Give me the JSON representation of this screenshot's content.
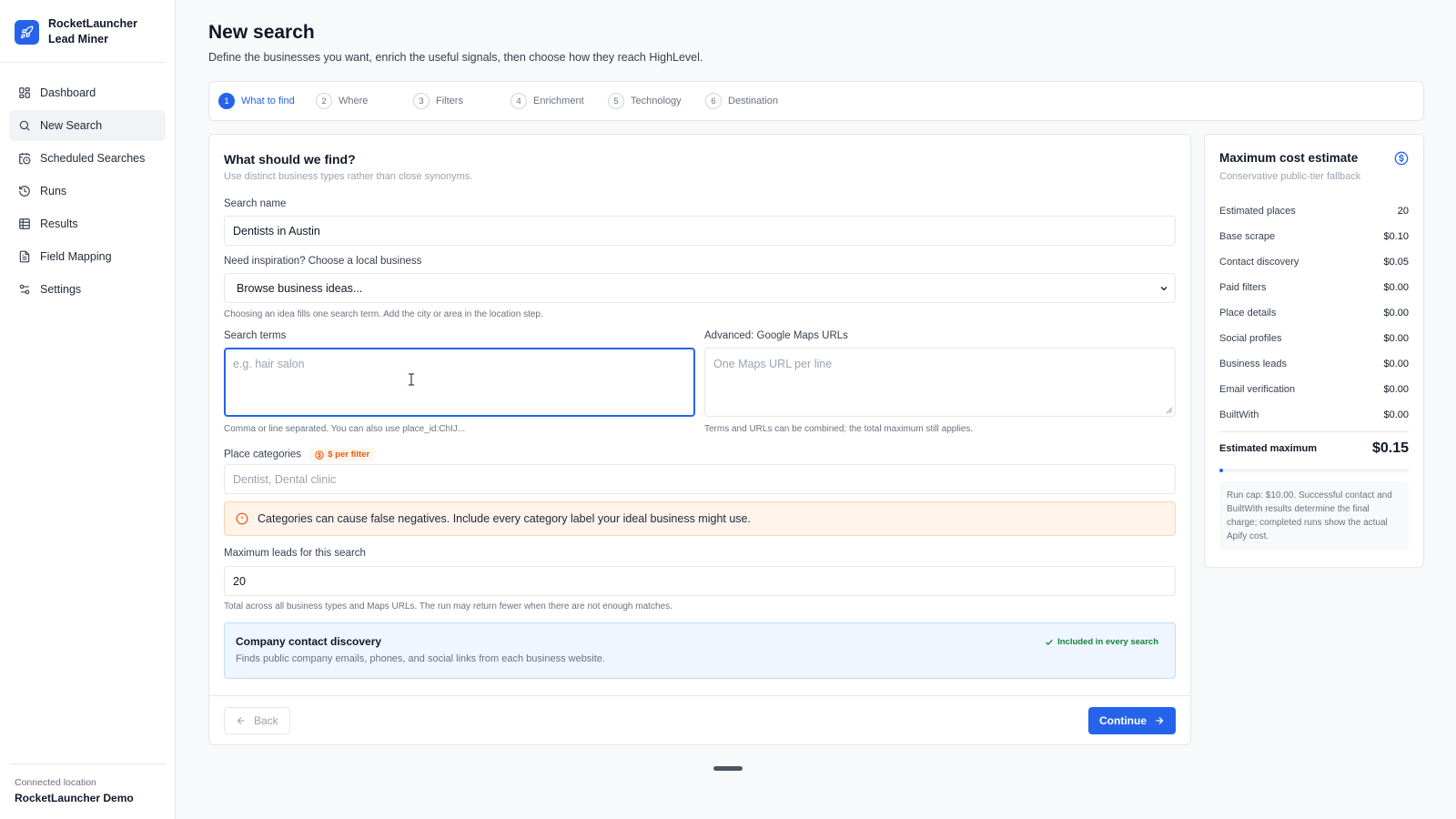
{
  "sidebar": {
    "brand_line1": "RocketLauncher",
    "brand_line2": "Lead Miner",
    "items": [
      {
        "label": "Dashboard"
      },
      {
        "label": "New Search"
      },
      {
        "label": "Scheduled Searches"
      },
      {
        "label": "Runs"
      },
      {
        "label": "Results"
      },
      {
        "label": "Field Mapping"
      },
      {
        "label": "Settings"
      }
    ],
    "footer_label": "Connected location",
    "footer_value": "RocketLauncher Demo"
  },
  "header": {
    "title": "New search",
    "subtitle": "Define the businesses you want, enrich the useful signals, then choose how they reach HighLevel."
  },
  "steps": [
    {
      "num": "1",
      "label": "What to find"
    },
    {
      "num": "2",
      "label": "Where"
    },
    {
      "num": "3",
      "label": "Filters"
    },
    {
      "num": "4",
      "label": "Enrichment"
    },
    {
      "num": "5",
      "label": "Technology"
    },
    {
      "num": "6",
      "label": "Destination"
    }
  ],
  "form": {
    "title": "What should we find?",
    "subtitle": "Use distinct business types rather than close synonyms.",
    "search_name_label": "Search name",
    "search_name_value": "Dentists in Austin",
    "inspiration_label": "Need inspiration? Choose a local business",
    "inspiration_value": "Browse business ideas...",
    "inspiration_help": "Choosing an idea fills one search term. Add the city or area in the location step.",
    "terms_label": "Search terms",
    "terms_placeholder": "e.g. hair salon",
    "terms_help": "Comma or line separated. You can also use place_id:ChIJ...",
    "urls_label": "Advanced: Google Maps URLs",
    "urls_placeholder": "One Maps URL per line",
    "urls_help": "Terms and URLs can be combined; the total maximum still applies.",
    "categories_label": "Place categories",
    "categories_badge": "$ per filter",
    "categories_placeholder": "Dentist, Dental clinic",
    "alert_text": "Categories can cause false negatives. Include every category label your ideal business might use.",
    "max_leads_label": "Maximum leads for this search",
    "max_leads_value": "20",
    "max_leads_help": "Total across all business types and Maps URLs. The run may return fewer when there are not enough matches.",
    "contact_title": "Company contact discovery",
    "contact_desc": "Finds public company emails, phones, and social links from each business website.",
    "contact_badge": "Included in every search",
    "back_label": "Back",
    "continue_label": "Continue"
  },
  "cost": {
    "title": "Maximum cost estimate",
    "subtitle": "Conservative public-tier fallback",
    "rows": [
      {
        "label": "Estimated places",
        "value": "20"
      },
      {
        "label": "Base scrape",
        "value": "$0.10"
      },
      {
        "label": "Contact discovery",
        "value": "$0.05"
      },
      {
        "label": "Paid filters",
        "value": "$0.00"
      },
      {
        "label": "Place details",
        "value": "$0.00"
      },
      {
        "label": "Social profiles",
        "value": "$0.00"
      },
      {
        "label": "Business leads",
        "value": "$0.00"
      },
      {
        "label": "Email verification",
        "value": "$0.00"
      },
      {
        "label": "BuiltWith",
        "value": "$0.00"
      }
    ],
    "estimated_label": "Estimated maximum",
    "estimated_value": "$0.15",
    "cap_fraction": 0.015,
    "note": "Run cap: $10.00. Successful contact and BuiltWith results determine the final charge; completed runs show the actual Apify cost."
  },
  "colors": {
    "accent": "#2563eb",
    "warning": "#ea580c",
    "success": "#15803d"
  }
}
